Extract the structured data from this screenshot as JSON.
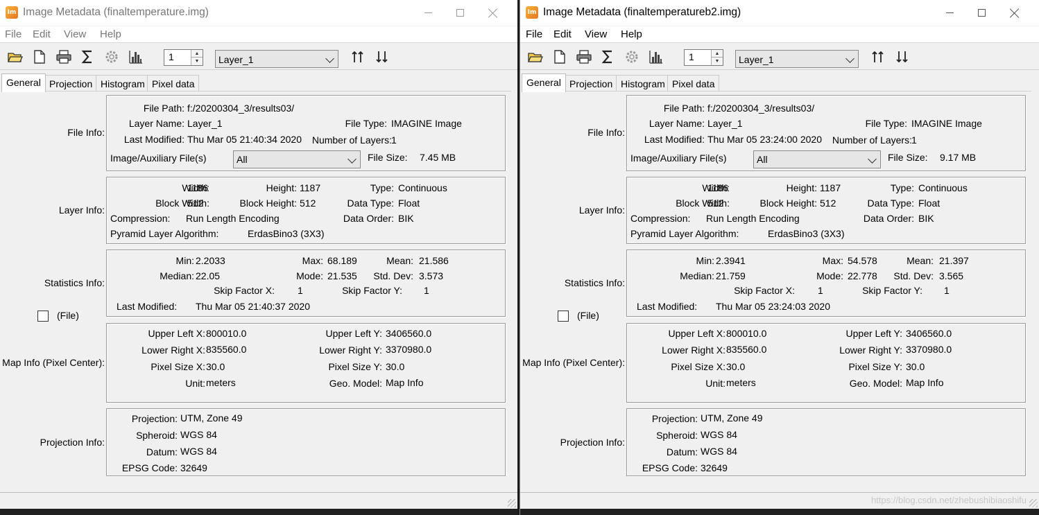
{
  "windows": [
    {
      "title": "Image Metadata (finaltemperature.img)",
      "menu": [
        "File",
        "Edit",
        "View",
        "Help"
      ],
      "toolbar": {
        "spinner_value": "1",
        "layer_select": "Layer_1"
      },
      "tabs": [
        "General",
        "Projection",
        "Histogram",
        "Pixel data"
      ],
      "active_tab": "General",
      "file_info": {
        "label": "File Info:",
        "file_path_label": "File Path:",
        "file_path": "f:/20200304_3/results03/",
        "layer_name_label": "Layer Name:",
        "layer_name": "Layer_1",
        "file_type_label": "File Type:",
        "file_type": "IMAGINE Image",
        "last_modified_label": "Last Modified:",
        "last_modified": "Thu Mar 05 21:40:34 2020",
        "num_layers_label": "Number of Layers:",
        "num_layers": "1",
        "aux_label": "Image/Auxiliary File(s)",
        "aux_value": "All",
        "file_size_label": "File Size:",
        "file_size": "7.45 MB"
      },
      "layer_info": {
        "label": "Layer Info:",
        "width_label": "Width:",
        "width": "1186",
        "height_label": "Height:",
        "height": "1187",
        "type_label": "Type:",
        "type": "Continuous",
        "block_width_label": "Block Width:",
        "block_width": "512",
        "block_height_label": "Block Height:",
        "block_height": "512",
        "data_type_label": "Data Type:",
        "data_type": "Float",
        "compression_label": "Compression:",
        "compression": "Run Length Encoding",
        "data_order_label": "Data Order:",
        "data_order": "BIK",
        "pyramid_label": "Pyramid Layer Algorithm:",
        "pyramid": "ErdasBino3 (3X3)"
      },
      "statistics_info": {
        "label": "Statistics Info:",
        "min_label": "Min:",
        "min": "2.2033",
        "max_label": "Max:",
        "max": "68.189",
        "mean_label": "Mean:",
        "mean": "21.586",
        "median_label": "Median:",
        "median": "22.05",
        "mode_label": "Mode:",
        "mode": "21.535",
        "std_label": "Std. Dev:",
        "std": "3.573",
        "skipx_label": "Skip Factor X:",
        "skipx": "1",
        "skipy_label": "Skip Factor Y:",
        "skipy": "1",
        "last_modified_label": "Last Modified:",
        "last_modified": "Thu Mar 05 21:40:37 2020",
        "file_checkbox_label": "(File)"
      },
      "map_info": {
        "label": "Map Info (Pixel Center):",
        "ulx_label": "Upper Left X:",
        "ulx": "800010.0",
        "uly_label": "Upper Left Y:",
        "uly": "3406560.0",
        "lrx_label": "Lower Right X:",
        "lrx": "835560.0",
        "lry_label": "Lower Right Y:",
        "lry": "3370980.0",
        "psx_label": "Pixel Size X:",
        "psx": "30.0",
        "psy_label": "Pixel Size Y:",
        "psy": "30.0",
        "unit_label": "Unit:",
        "unit": "meters",
        "geo_label": "Geo. Model:",
        "geo": "Map Info"
      },
      "projection_info": {
        "label": "Projection Info:",
        "projection_label": "Projection:",
        "projection": "UTM, Zone 49",
        "spheroid_label": "Spheroid:",
        "spheroid": "WGS 84",
        "datum_label": "Datum:",
        "datum": "WGS 84",
        "epsg_label": "EPSG Code:",
        "epsg": "32649"
      }
    },
    {
      "title": "Image Metadata (finaltemperatureb2.img)",
      "menu": [
        "File",
        "Edit",
        "View",
        "Help"
      ],
      "toolbar": {
        "spinner_value": "1",
        "layer_select": "Layer_1"
      },
      "tabs": [
        "General",
        "Projection",
        "Histogram",
        "Pixel data"
      ],
      "active_tab": "General",
      "file_info": {
        "label": "File Info:",
        "file_path_label": "File Path:",
        "file_path": "f:/20200304_3/results03/",
        "layer_name_label": "Layer Name:",
        "layer_name": "Layer_1",
        "file_type_label": "File Type:",
        "file_type": "IMAGINE Image",
        "last_modified_label": "Last Modified:",
        "last_modified": "Thu Mar 05 23:24:00 2020",
        "num_layers_label": "Number of Layers:",
        "num_layers": "1",
        "aux_label": "Image/Auxiliary File(s)",
        "aux_value": "All",
        "file_size_label": "File Size:",
        "file_size": "9.17 MB"
      },
      "layer_info": {
        "label": "Layer Info:",
        "width_label": "Width:",
        "width": "1186",
        "height_label": "Height:",
        "height": "1187",
        "type_label": "Type:",
        "type": "Continuous",
        "block_width_label": "Block Width:",
        "block_width": "512",
        "block_height_label": "Block Height:",
        "block_height": "512",
        "data_type_label": "Data Type:",
        "data_type": "Float",
        "compression_label": "Compression:",
        "compression": "Run Length Encoding",
        "data_order_label": "Data Order:",
        "data_order": "BIK",
        "pyramid_label": "Pyramid Layer Algorithm:",
        "pyramid": "ErdasBino3 (3X3)"
      },
      "statistics_info": {
        "label": "Statistics Info:",
        "min_label": "Min:",
        "min": "2.3941",
        "max_label": "Max:",
        "max": "54.578",
        "mean_label": "Mean:",
        "mean": "21.397",
        "median_label": "Median:",
        "median": "21.759",
        "mode_label": "Mode:",
        "mode": "22.778",
        "std_label": "Std. Dev:",
        "std": "3.565",
        "skipx_label": "Skip Factor X:",
        "skipx": "1",
        "skipy_label": "Skip Factor Y:",
        "skipy": "1",
        "last_modified_label": "Last Modified:",
        "last_modified": "Thu Mar 05 23:24:03 2020",
        "file_checkbox_label": "(File)"
      },
      "map_info": {
        "label": "Map Info (Pixel Center):",
        "ulx_label": "Upper Left X:",
        "ulx": "800010.0",
        "uly_label": "Upper Left Y:",
        "uly": "3406560.0",
        "lrx_label": "Lower Right X:",
        "lrx": "835560.0",
        "lry_label": "Lower Right Y:",
        "lry": "3370980.0",
        "psx_label": "Pixel Size X:",
        "psx": "30.0",
        "psy_label": "Pixel Size Y:",
        "psy": "30.0",
        "unit_label": "Unit:",
        "unit": "meters",
        "geo_label": "Geo. Model:",
        "geo": "Map Info"
      },
      "projection_info": {
        "label": "Projection Info:",
        "projection_label": "Projection:",
        "projection": "UTM, Zone 49",
        "spheroid_label": "Spheroid:",
        "spheroid": "WGS 84",
        "datum_label": "Datum:",
        "datum": "WGS 84",
        "epsg_label": "EPSG Code:",
        "epsg": "32649"
      }
    }
  ],
  "watermark": "https://blog.csdn.net/zhebushibiaoshifu"
}
